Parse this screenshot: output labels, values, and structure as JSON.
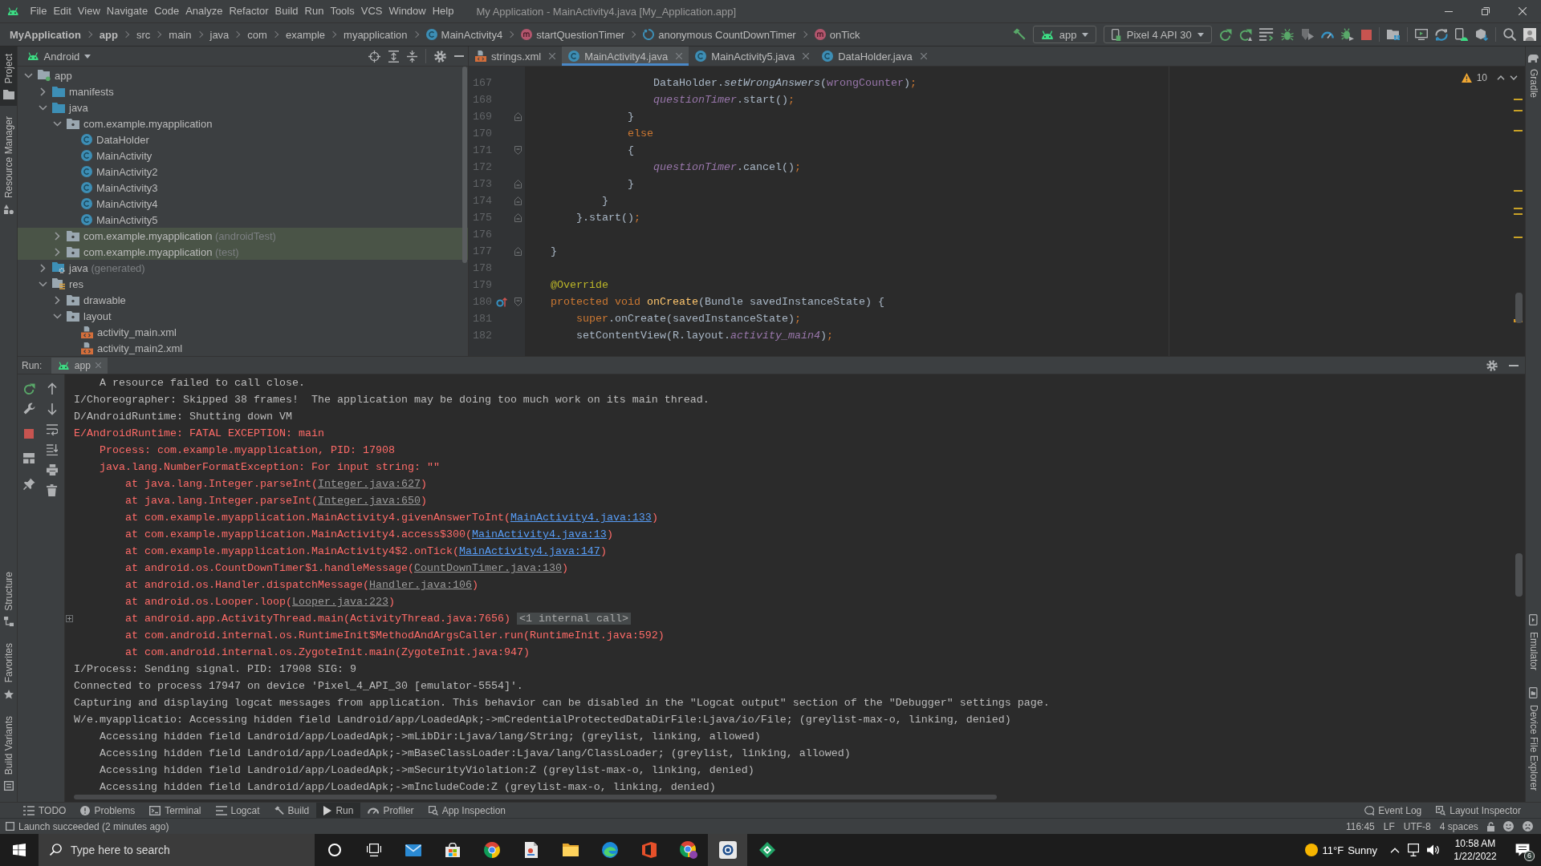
{
  "title_bar": {
    "menus": [
      "File",
      "Edit",
      "View",
      "Navigate",
      "Code",
      "Analyze",
      "Refactor",
      "Build",
      "Run",
      "Tools",
      "VCS",
      "Window",
      "Help"
    ],
    "title": "My Application - MainActivity4.java [My_Application.app]"
  },
  "navigation_bar": {
    "breadcrumbs": [
      {
        "label": "MyApplication",
        "kind": "project"
      },
      {
        "label": "app",
        "kind": "module"
      },
      {
        "label": "src",
        "kind": "folder"
      },
      {
        "label": "main",
        "kind": "folder"
      },
      {
        "label": "java",
        "kind": "folder"
      },
      {
        "label": "com",
        "kind": "folder"
      },
      {
        "label": "example",
        "kind": "folder"
      },
      {
        "label": "myapplication",
        "kind": "folder"
      },
      {
        "label": "MainActivity4",
        "kind": "class"
      },
      {
        "label": "startQuestionTimer",
        "kind": "method"
      },
      {
        "label": "anonymous CountDownTimer",
        "kind": "anonymous"
      },
      {
        "label": "onTick",
        "kind": "method"
      }
    ],
    "run_configuration": "app",
    "device": "Pixel 4 API 30"
  },
  "left_tool_strip": {
    "top": [
      {
        "label": "Project",
        "kind": "project",
        "selected": true
      },
      {
        "label": "Resource Manager",
        "kind": "resources",
        "selected": false
      }
    ],
    "bottom": [
      {
        "label": "Structure",
        "kind": "structure",
        "selected": false
      },
      {
        "label": "Favorites",
        "kind": "favorites",
        "selected": false
      },
      {
        "label": "Build Variants",
        "kind": "variants",
        "selected": false
      }
    ]
  },
  "right_tool_strip": {
    "top": [
      {
        "label": "Gradle",
        "kind": "gradle",
        "selected": false
      }
    ],
    "bottom": [
      {
        "label": "Emulator",
        "kind": "emulator",
        "selected": false
      },
      {
        "label": "Device File Explorer",
        "kind": "explorer",
        "selected": false
      }
    ]
  },
  "project_panel": {
    "view": "Android",
    "tree": [
      {
        "label": "app",
        "kind": "module",
        "expanded": true,
        "children": [
          {
            "label": "manifests",
            "kind": "sourcefolder",
            "expanded": false
          },
          {
            "label": "java",
            "kind": "sourcefolder",
            "expanded": true,
            "children": [
              {
                "label": "com.example.myapplication",
                "kind": "package",
                "expanded": true,
                "children": [
                  {
                    "label": "DataHolder",
                    "kind": "class"
                  },
                  {
                    "label": "MainActivity",
                    "kind": "class"
                  },
                  {
                    "label": "MainActivity2",
                    "kind": "class"
                  },
                  {
                    "label": "MainActivity3",
                    "kind": "class"
                  },
                  {
                    "label": "MainActivity4",
                    "kind": "class"
                  },
                  {
                    "label": "MainActivity5",
                    "kind": "class"
                  }
                ]
              },
              {
                "label": "com.example.myapplication",
                "hint": "(androidTest)",
                "kind": "testpackage",
                "expanded": false
              },
              {
                "label": "com.example.myapplication",
                "hint": "(test)",
                "kind": "testpackage",
                "expanded": false
              }
            ]
          },
          {
            "label": "java",
            "hint": "(generated)",
            "kind": "generated",
            "expanded": false
          },
          {
            "label": "res",
            "kind": "resfolder",
            "expanded": true,
            "children": [
              {
                "label": "drawable",
                "kind": "folder",
                "expanded": false
              },
              {
                "label": "layout",
                "kind": "folder",
                "expanded": true,
                "children": [
                  {
                    "label": "activity_main.xml",
                    "kind": "layoutfile"
                  },
                  {
                    "label": "activity_main2.xml",
                    "kind": "layoutfile"
                  }
                ]
              }
            ]
          }
        ]
      }
    ]
  },
  "editor": {
    "tabs": [
      {
        "label": "strings.xml",
        "kind": "xml",
        "selected": false
      },
      {
        "label": "MainActivity4.java",
        "kind": "class",
        "selected": true
      },
      {
        "label": "MainActivity5.java",
        "kind": "class",
        "selected": false
      },
      {
        "label": "DataHolder.java",
        "kind": "class",
        "selected": false
      }
    ],
    "warning_count": "10",
    "lines": [
      {
        "number": "167",
        "tokens": [
          {
            "text": "                    DataHolder.",
            "kind": "plain"
          },
          {
            "text": "setWrongAnswers",
            "kind": "static-call"
          },
          {
            "text": "(",
            "kind": "plain"
          },
          {
            "text": "wrongCounter",
            "kind": "field"
          },
          {
            "text": ")",
            "kind": "plain"
          },
          {
            "text": ";",
            "kind": "punct"
          }
        ]
      },
      {
        "number": "168",
        "tokens": [
          {
            "text": "                    questionTimer",
            "kind": "static-field"
          },
          {
            "text": ".start()",
            "kind": "plain"
          },
          {
            "text": ";",
            "kind": "punct"
          }
        ]
      },
      {
        "number": "169",
        "gutter": [
          {
            "kind": "fold-end"
          }
        ],
        "tokens": [
          {
            "text": "                }",
            "kind": "plain"
          }
        ]
      },
      {
        "number": "170",
        "tokens": [
          {
            "text": "                else",
            "kind": "keyword"
          }
        ]
      },
      {
        "number": "171",
        "gutter": [
          {
            "kind": "fold-start"
          }
        ],
        "tokens": [
          {
            "text": "                {",
            "kind": "plain"
          }
        ]
      },
      {
        "number": "172",
        "tokens": [
          {
            "text": "                    questionTimer",
            "kind": "static-field"
          },
          {
            "text": ".cancel()",
            "kind": "plain"
          },
          {
            "text": ";",
            "kind": "punct"
          }
        ]
      },
      {
        "number": "173",
        "gutter": [
          {
            "kind": "fold-end"
          }
        ],
        "tokens": [
          {
            "text": "                }",
            "kind": "plain"
          }
        ]
      },
      {
        "number": "174",
        "gutter": [
          {
            "kind": "fold-end"
          }
        ],
        "tokens": [
          {
            "text": "            }",
            "kind": "plain"
          }
        ]
      },
      {
        "number": "175",
        "gutter": [
          {
            "kind": "fold-end"
          }
        ],
        "tokens": [
          {
            "text": "        }.start()",
            "kind": "plain"
          },
          {
            "text": ";",
            "kind": "punct"
          }
        ]
      },
      {
        "number": "176"
      },
      {
        "number": "177",
        "gutter": [
          {
            "kind": "fold-end"
          }
        ],
        "tokens": [
          {
            "text": "    }",
            "kind": "plain"
          }
        ]
      },
      {
        "number": "178"
      },
      {
        "number": "179",
        "tokens": [
          {
            "text": "    @Override",
            "kind": "annotation"
          }
        ]
      },
      {
        "number": "180",
        "gutter": [
          {
            "kind": "override"
          },
          {
            "kind": "fold-start"
          }
        ],
        "tokens": [
          {
            "text": "    protected void ",
            "kind": "keyword"
          },
          {
            "text": "onCreate",
            "kind": "declaration"
          },
          {
            "text": "(Bundle savedInstanceState) {",
            "kind": "plain"
          }
        ]
      },
      {
        "number": "181",
        "tokens": [
          {
            "text": "        super",
            "kind": "keyword"
          },
          {
            "text": ".onCreate(savedInstanceState)",
            "kind": "plain"
          },
          {
            "text": ";",
            "kind": "punct"
          }
        ]
      },
      {
        "number": "182",
        "tokens": [
          {
            "text": "        setContentView(R.layout.",
            "kind": "plain"
          },
          {
            "text": "activity_main4",
            "kind": "static-field"
          },
          {
            "text": ")",
            "kind": "plain"
          },
          {
            "text": ";",
            "kind": "punct"
          }
        ]
      }
    ]
  },
  "run_panel": {
    "label": "Run:",
    "tabs": [
      {
        "label": "app",
        "selected": true
      }
    ],
    "console": [
      {
        "error": false,
        "children": [
          {
            "text": "A resource failed to call close."
          }
        ]
      },
      {
        "error": false,
        "text": "I/Choreographer: Skipped 38 frames!  The application may be doing too much work on its main thread."
      },
      {
        "error": false,
        "text": "D/AndroidRuntime: Shutting down VM"
      },
      {
        "error": true,
        "text": "E/AndroidRuntime: FATAL EXCEPTION: main",
        "children": [
          {
            "text": "Process: com.example.myapplication, PID: 17908"
          },
          {
            "text": "java.lang.NumberFormatException: For input string: \"\"",
            "children": [
              {
                "text": "at java.lang.Integer.parseInt(",
                "source": {
                  "text": "Integer.java:627",
                  "project": false
                },
                "after": ")"
              },
              {
                "text": "at java.lang.Integer.parseInt(",
                "source": {
                  "text": "Integer.java:650",
                  "project": false
                },
                "after": ")"
              },
              {
                "text": "at com.example.myapplication.MainActivity4.givenAnswerToInt(",
                "source": {
                  "text": "MainActivity4.java:133",
                  "project": true
                },
                "after": ")"
              },
              {
                "text": "at com.example.myapplication.MainActivity4.access$300(",
                "source": {
                  "text": "MainActivity4.java:13",
                  "project": true
                },
                "after": ")"
              },
              {
                "text": "at com.example.myapplication.MainActivity4$2.onTick(",
                "source": {
                  "text": "MainActivity4.java:147",
                  "project": true
                },
                "after": ")"
              },
              {
                "text": "at android.os.CountDownTimer$1.handleMessage(",
                "source": {
                  "text": "CountDownTimer.java:130",
                  "project": false
                },
                "after": ")"
              },
              {
                "text": "at android.os.Handler.dispatchMessage(",
                "source": {
                  "text": "Handler.java:106",
                  "project": false
                },
                "after": ")"
              },
              {
                "text": "at android.os.Looper.loop(",
                "source": {
                  "text": "Looper.java:223",
                  "project": false
                },
                "after": ")"
              },
              {
                "text": "at android.app.ActivityThread.main(ActivityThread.java:7656)",
                "note": "<1 internal call>"
              },
              {
                "text": "at com.android.internal.os.RuntimeInit$MethodAndArgsCaller.run(RuntimeInit.java:592)"
              },
              {
                "text": "at com.android.internal.os.ZygoteInit.main(ZygoteInit.java:947)"
              }
            ]
          }
        ]
      },
      {
        "error": false,
        "text": "I/Process: Sending signal. PID: 17908 SIG: 9"
      },
      {
        "error": false,
        "text": "Connected to process 17947 on device 'Pixel_4_API_30 [emulator-5554]'."
      },
      {
        "error": false,
        "text": "Capturing and displaying logcat messages from application. This behavior can be disabled in the \"Logcat output\" section of the \"Debugger\" settings page."
      },
      {
        "error": false,
        "text": "W/e.myapplicatio: Accessing hidden field Landroid/app/LoadedApk;->mCredentialProtectedDataDirFile:Ljava/io/File; (greylist-max-o, linking, denied)",
        "children": [
          {
            "text": "Accessing hidden field Landroid/app/LoadedApk;->mLibDir:Ljava/lang/String; (greylist, linking, allowed)"
          },
          {
            "text": "Accessing hidden field Landroid/app/LoadedApk;->mBaseClassLoader:Ljava/lang/ClassLoader; (greylist, linking, allowed)"
          },
          {
            "text": "Accessing hidden field Landroid/app/LoadedApk;->mSecurityViolation:Z (greylist-max-o, linking, denied)"
          },
          {
            "text": "Accessing hidden field Landroid/app/LoadedApk;->mIncludeCode:Z (greylist-max-o, linking, denied)"
          }
        ]
      }
    ]
  },
  "tool_window_bar": {
    "left": [
      {
        "label": "TODO",
        "kind": "todo",
        "selected": false
      },
      {
        "label": "Problems",
        "kind": "problems",
        "selected": false
      },
      {
        "label": "Terminal",
        "kind": "terminal",
        "selected": false
      },
      {
        "label": "Logcat",
        "kind": "logcat",
        "selected": false
      },
      {
        "label": "Build",
        "kind": "build",
        "selected": false
      },
      {
        "label": "Run",
        "kind": "run",
        "selected": true
      },
      {
        "label": "Profiler",
        "kind": "profiler",
        "selected": false
      },
      {
        "label": "App Inspection",
        "kind": "inspection",
        "selected": false
      }
    ],
    "right": [
      {
        "label": "Event Log",
        "kind": "eventlog",
        "selected": false
      },
      {
        "label": "Layout Inspector",
        "kind": "inspector",
        "selected": false
      }
    ]
  },
  "status_bar": {
    "message": "Launch succeeded (2 minutes ago)",
    "items": [
      "116:45",
      "LF",
      "UTF-8",
      "4 spaces"
    ]
  },
  "taskbar": {
    "search_placeholder": "Type here to search",
    "apps": [
      {
        "kind": "circle",
        "selected": false
      },
      {
        "kind": "taskview",
        "selected": false
      },
      {
        "kind": "mail",
        "selected": false
      },
      {
        "kind": "store",
        "selected": false
      },
      {
        "kind": "wheel",
        "selected": false
      },
      {
        "kind": "document",
        "selected": false
      },
      {
        "kind": "folder",
        "selected": false
      },
      {
        "kind": "wave",
        "selected": false
      },
      {
        "kind": "bracket",
        "selected": false
      },
      {
        "kind": "wheelbadge",
        "selected": false
      },
      {
        "kind": "tile",
        "selected": true
      },
      {
        "kind": "diamond",
        "selected": false
      }
    ],
    "weather": {
      "temperature": "11°F",
      "condition": "Sunny"
    },
    "time": "10:58 AM",
    "date": "1/22/2022",
    "notifications": "6"
  }
}
